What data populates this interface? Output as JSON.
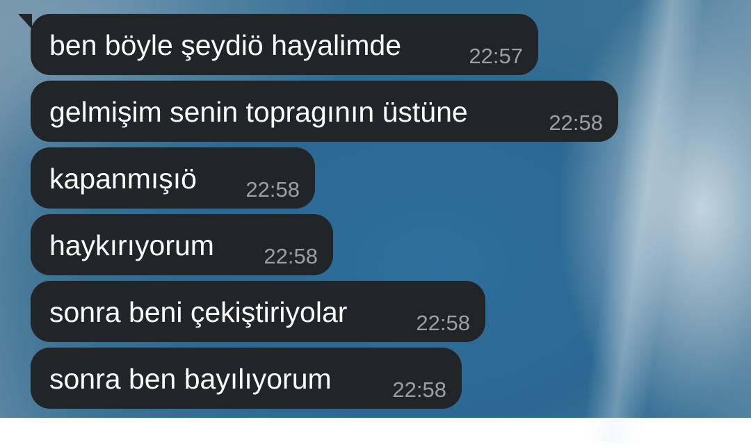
{
  "chat": {
    "messages": [
      {
        "text": "ben böyle şeydiö hayalimde",
        "time": "22:57"
      },
      {
        "text": "gelmişim senin topragının üstüne",
        "time": "22:58"
      },
      {
        "text": "kapanmışıö",
        "time": "22:58"
      },
      {
        "text": "haykırıyorum",
        "time": "22:58"
      },
      {
        "text": "sonra beni çekiştiriyolar",
        "time": "22:58"
      },
      {
        "text": "sonra ben bayılıyorum",
        "time": "22:58"
      }
    ]
  },
  "colors": {
    "bubble": "#212528",
    "message_text": "#ffffff",
    "timestamp": "#9aa0a6",
    "wallpaper_accent": "#2d6a94"
  }
}
